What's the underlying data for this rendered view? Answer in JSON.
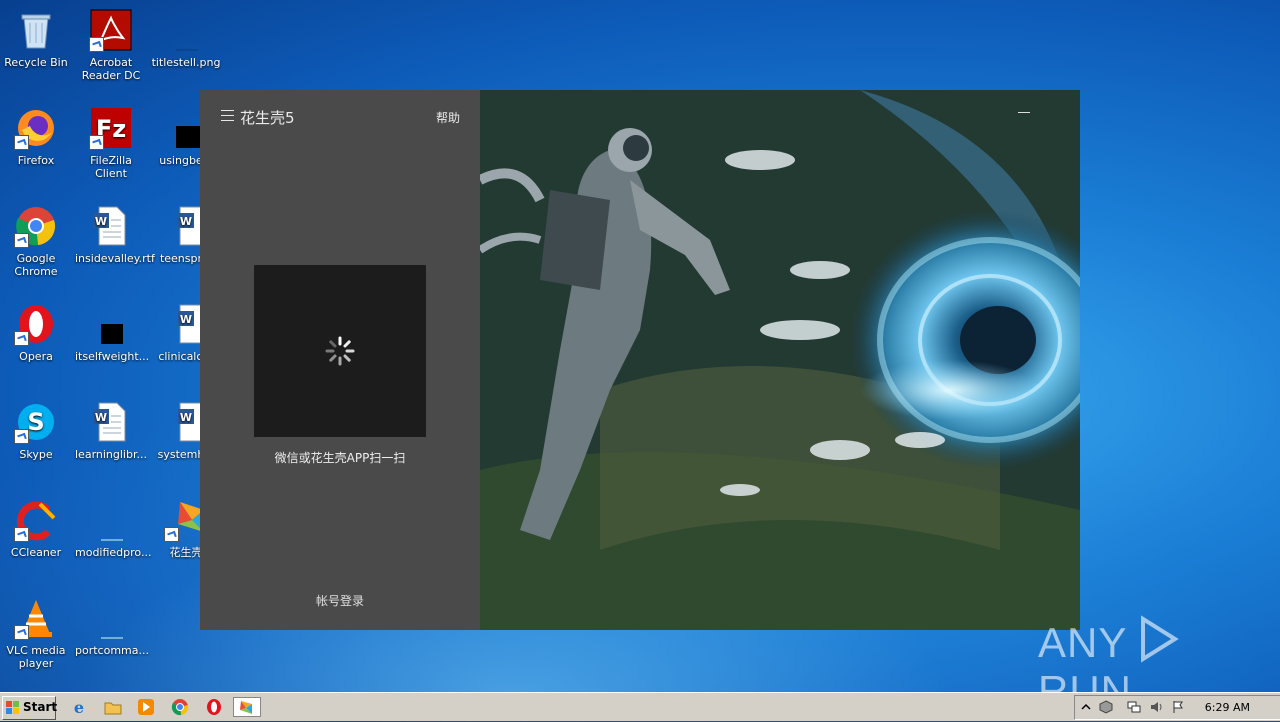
{
  "desktop": {
    "icons": [
      {
        "label": "Recycle Bin"
      },
      {
        "label": "Acrobat Reader DC"
      },
      {
        "label": "titlestell.png"
      },
      {
        "label": "Firefox"
      },
      {
        "label": "FileZilla Client"
      },
      {
        "label": "usingbest"
      },
      {
        "label": "Google Chrome"
      },
      {
        "label": "insidevalley.rtf"
      },
      {
        "label": "teensprin"
      },
      {
        "label": "Opera"
      },
      {
        "label": "itselfweight..."
      },
      {
        "label": "clinicalcar"
      },
      {
        "label": "Skype"
      },
      {
        "label": "learninglibr..."
      },
      {
        "label": "systemhig"
      },
      {
        "label": "CCleaner"
      },
      {
        "label": "modifiedpro..."
      },
      {
        "label": "花生壳"
      },
      {
        "label": "VLC media player"
      },
      {
        "label": "portcomma..."
      }
    ]
  },
  "app": {
    "title": "花生壳5",
    "help_label": "帮助",
    "scan_hint": "微信或花生壳APP扫一扫",
    "account_login_label": "帐号登录"
  },
  "taskbar": {
    "start_label": "Start",
    "clock": "6:29 AM"
  },
  "watermark": {
    "left_text": "ANY",
    "right_text": "RUN"
  }
}
